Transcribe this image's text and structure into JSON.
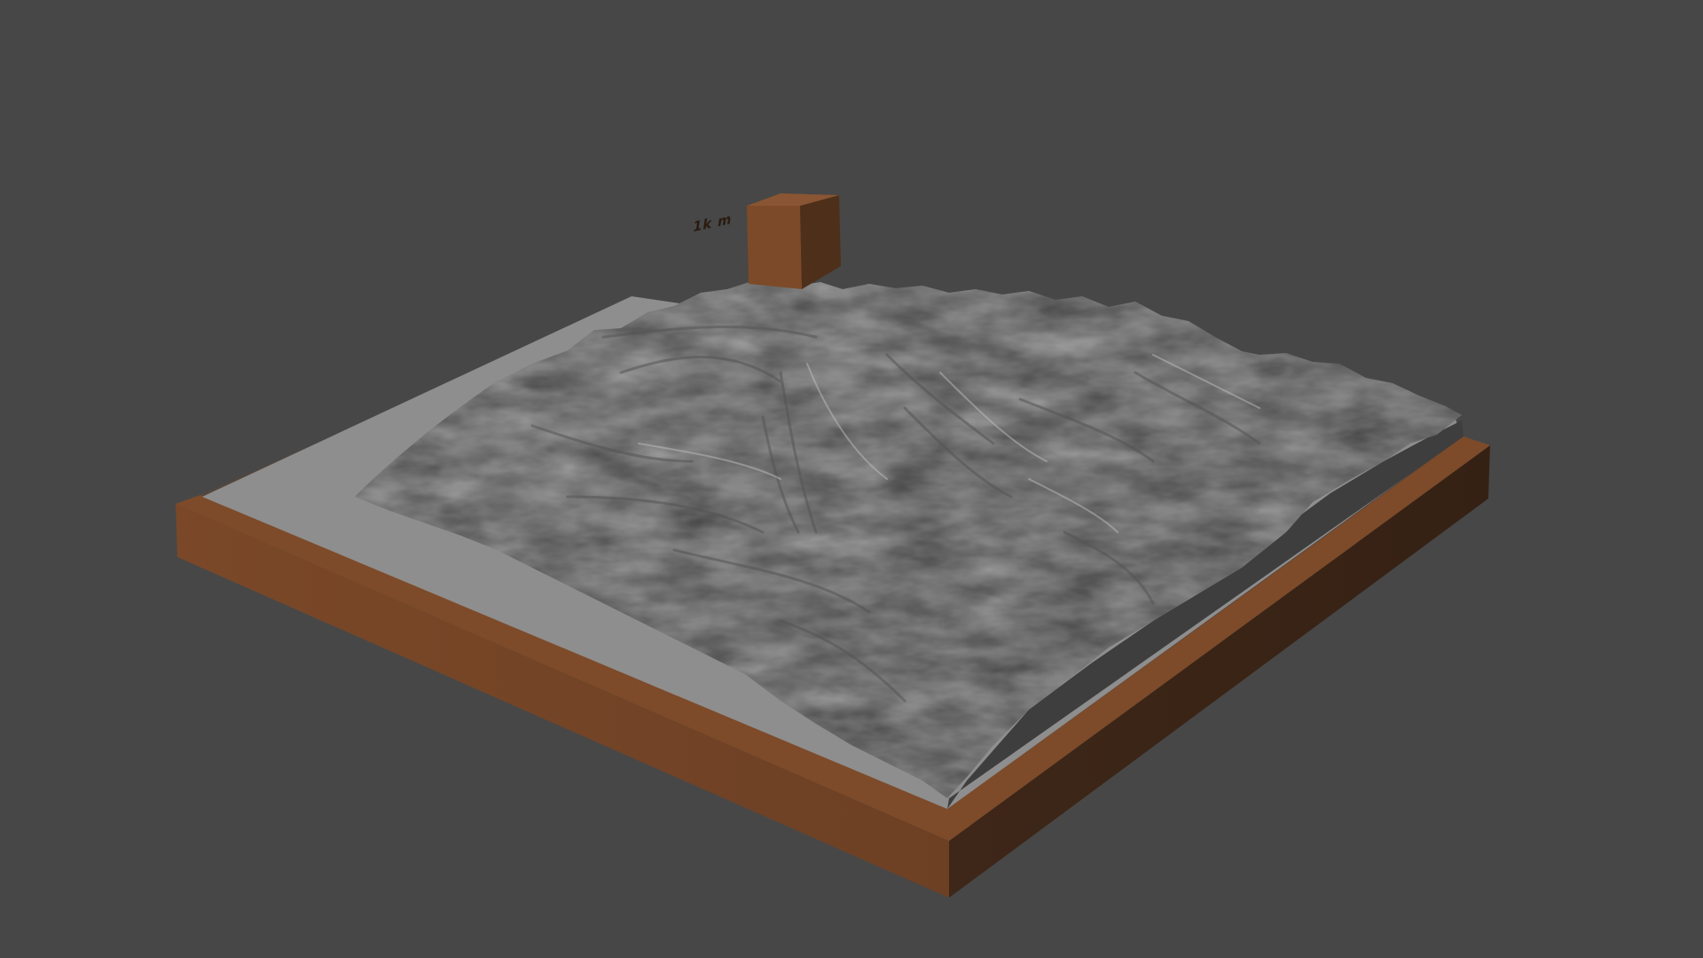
{
  "viewport": {
    "background_color": "#474747"
  },
  "terrain_model": {
    "base_color_light": "#744526",
    "base_color_dark": "#3a2417",
    "terrain_color": "#8e8e8e",
    "terrain_shadow_color": "#5c5c5c",
    "terrain_highlight_color": "#b4b4b4"
  },
  "scale_tag": {
    "label": "1k m",
    "color_front": "#7c4a28",
    "color_side": "#4e2f1a",
    "color_top": "#8a5532"
  }
}
